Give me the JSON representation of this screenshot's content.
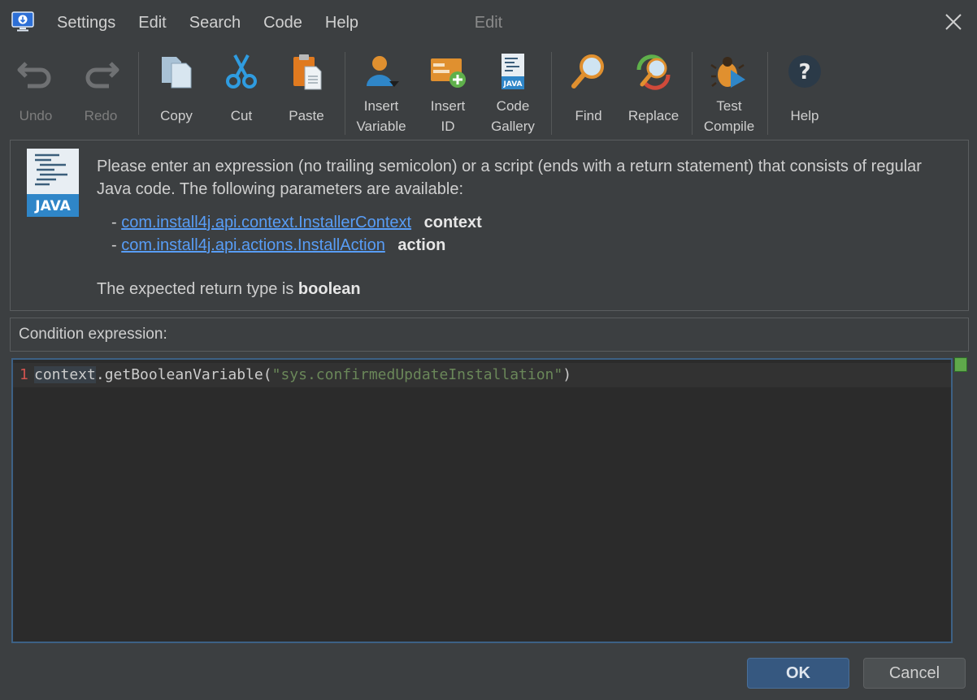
{
  "menu": [
    "Settings",
    "Edit",
    "Search",
    "Code",
    "Help"
  ],
  "window_title": "Edit",
  "toolbar": {
    "undo": "Undo",
    "redo": "Redo",
    "copy": "Copy",
    "cut": "Cut",
    "paste": "Paste",
    "insert_variable": "Insert\nVariable",
    "insert_id": "Insert\nID",
    "code_gallery": "Code\nGallery",
    "find": "Find",
    "replace": "Replace",
    "test_compile": "Test\nCompile",
    "help": "Help"
  },
  "info": {
    "java_label": "JAVA",
    "description": "Please enter an expression (no trailing semicolon) or a script (ends with a return statement) that consists of regular Java code. The following parameters are available:",
    "params": [
      {
        "type": "com.install4j.api.context.InstallerContext",
        "name": "context"
      },
      {
        "type": "com.install4j.api.actions.InstallAction",
        "name": "action"
      }
    ],
    "return_prefix": "The expected return type is ",
    "return_type": "boolean"
  },
  "condition_label": "Condition expression:",
  "editor": {
    "line_number": "1",
    "code_ident": "context",
    "code_call": ".getBooleanVariable(",
    "code_string": "\"sys.confirmedUpdateInstallation\"",
    "code_end": ")"
  },
  "buttons": {
    "ok": "OK",
    "cancel": "Cancel"
  },
  "colors": {
    "accent": "#365880",
    "link": "#589df6",
    "string": "#6a8759",
    "line_number": "#d0534f"
  }
}
